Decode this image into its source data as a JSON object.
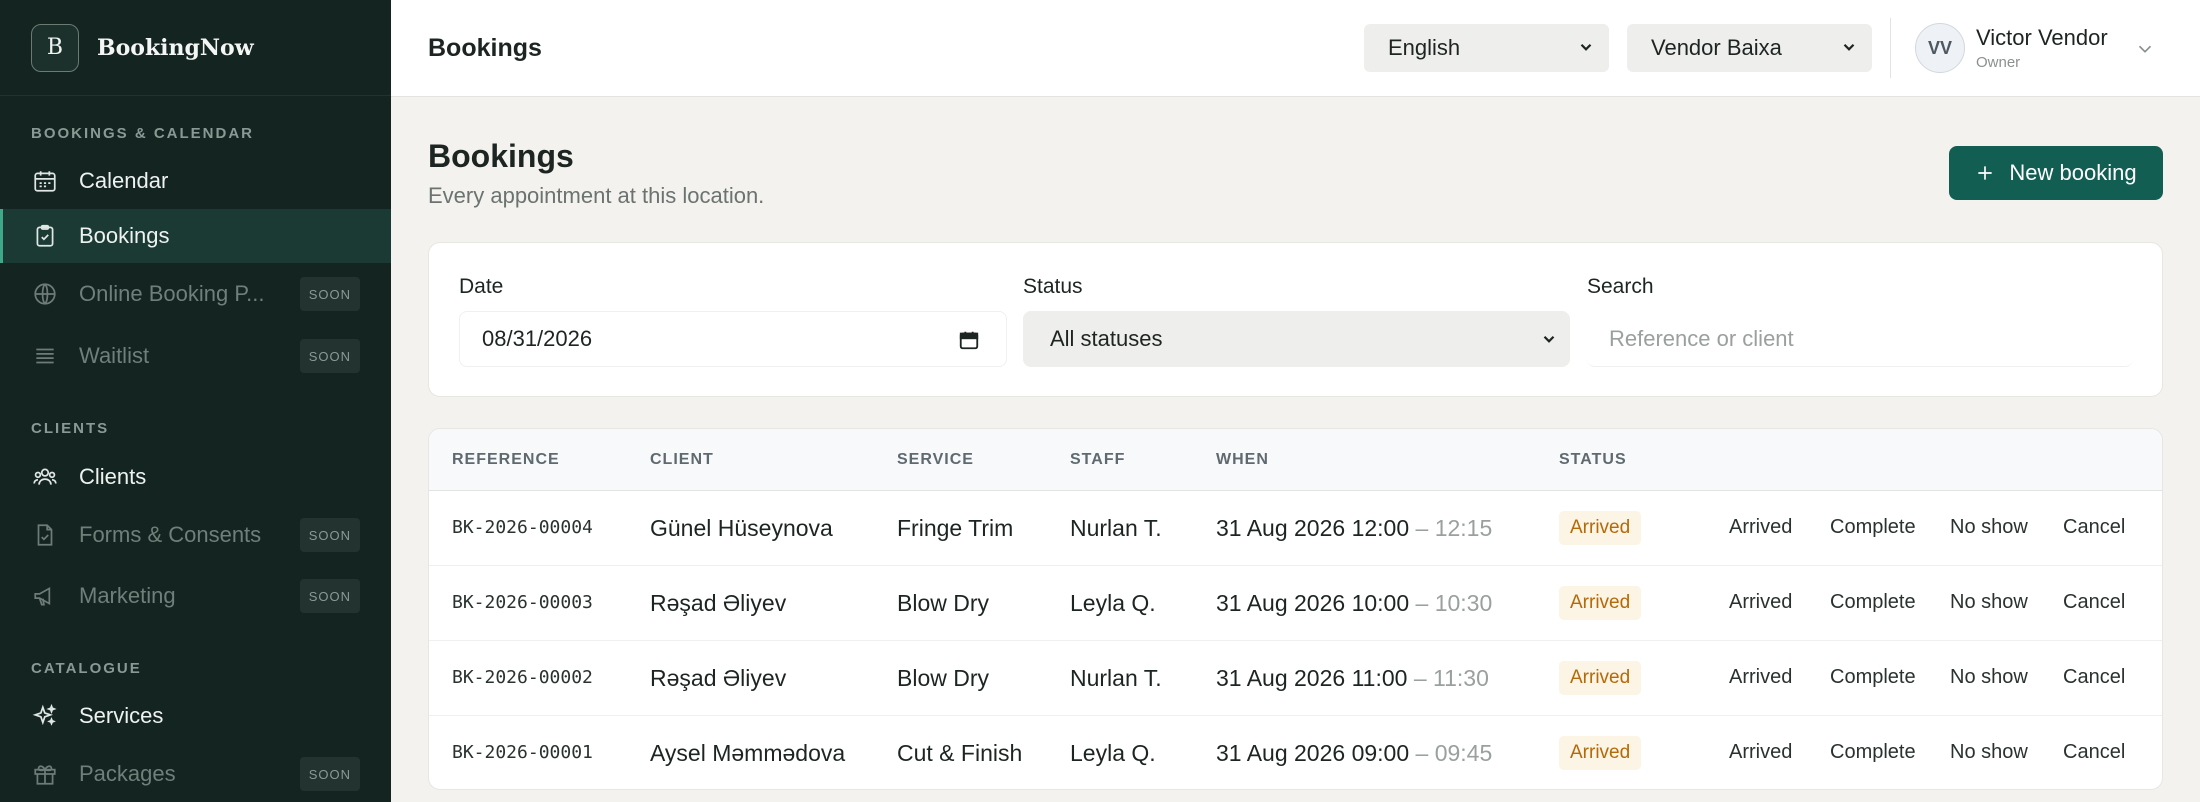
{
  "brand": {
    "logo_letter": "B",
    "name": "BookingNow"
  },
  "sidebar": {
    "sections": [
      {
        "label": "BOOKINGS & CALENDAR"
      },
      {
        "label": "CLIENTS"
      },
      {
        "label": "CATALOGUE"
      }
    ],
    "items": [
      {
        "label": "Calendar",
        "icon": "calendar-icon"
      },
      {
        "label": "Bookings",
        "icon": "clipboard-check-icon",
        "active": true
      },
      {
        "label": "Online Booking P...",
        "icon": "globe-icon",
        "badge": "SOON"
      },
      {
        "label": "Waitlist",
        "icon": "list-icon",
        "badge": "SOON"
      },
      {
        "label": "Clients",
        "icon": "users-icon"
      },
      {
        "label": "Forms & Consents",
        "icon": "document-check-icon",
        "badge": "SOON"
      },
      {
        "label": "Marketing",
        "icon": "megaphone-icon",
        "badge": "SOON"
      },
      {
        "label": "Services",
        "icon": "sparkles-icon"
      },
      {
        "label": "Packages",
        "icon": "gift-icon",
        "badge": "SOON"
      }
    ]
  },
  "header": {
    "title": "Bookings",
    "language": "English",
    "vendor": "Vendor Baixa",
    "user": {
      "initials": "VV",
      "name": "Victor Vendor",
      "role": "Owner"
    }
  },
  "main": {
    "title": "Bookings",
    "subtitle": "Every appointment at this location.",
    "new_button": "New booking",
    "filters": {
      "date_label": "Date",
      "date_value": "08/31/2026",
      "status_label": "Status",
      "status_value": "All statuses",
      "search_label": "Search",
      "search_placeholder": "Reference or client"
    },
    "table": {
      "columns": [
        "REFERENCE",
        "CLIENT",
        "SERVICE",
        "STAFF",
        "WHEN",
        "STATUS"
      ],
      "actions": [
        "Arrived",
        "Complete",
        "No show",
        "Cancel"
      ],
      "rows": [
        {
          "reference": "BK-2026-00004",
          "client": "Günel Hüseynova",
          "service": "Fringe Trim",
          "staff": "Nurlan T.",
          "when_start": "31 Aug 2026 12:00",
          "when_end": "– 12:15",
          "status": "Arrived"
        },
        {
          "reference": "BK-2026-00003",
          "client": "Rəşad Əliyev",
          "service": "Blow Dry",
          "staff": "Leyla Q.",
          "when_start": "31 Aug 2026 10:00",
          "when_end": "– 10:30",
          "status": "Arrived"
        },
        {
          "reference": "BK-2026-00002",
          "client": "Rəşad Əliyev",
          "service": "Blow Dry",
          "staff": "Nurlan T.",
          "when_start": "31 Aug 2026 11:00",
          "when_end": "– 11:30",
          "status": "Arrived"
        },
        {
          "reference": "BK-2026-00001",
          "client": "Aysel Məmmədova",
          "service": "Cut & Finish",
          "staff": "Leyla Q.",
          "when_start": "31 Aug 2026 09:00",
          "when_end": "– 09:45",
          "status": "Arrived"
        }
      ]
    }
  },
  "colors": {
    "sidebar_bg": "#132421",
    "accent": "#135e52",
    "status_badge_text": "#b36a07",
    "status_badge_bg": "#fcf4e4"
  }
}
